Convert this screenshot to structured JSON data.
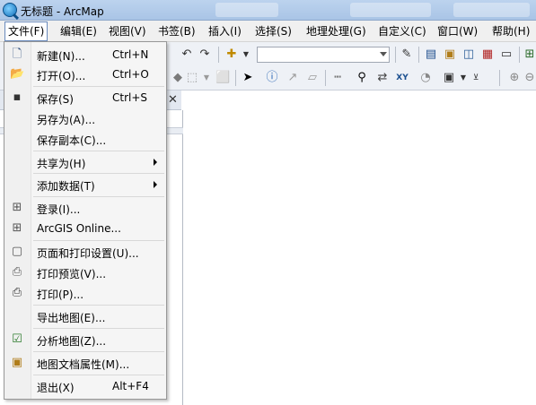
{
  "window": {
    "title": "无标题 - ArcMap"
  },
  "menubar": {
    "items": [
      {
        "label": "文件(F)"
      },
      {
        "label": "编辑(E)"
      },
      {
        "label": "视图(V)"
      },
      {
        "label": "书签(B)"
      },
      {
        "label": "插入(I)"
      },
      {
        "label": "选择(S)"
      },
      {
        "label": "地理处理(G)"
      },
      {
        "label": "自定义(C)"
      },
      {
        "label": "窗口(W)"
      },
      {
        "label": "帮助(H)"
      }
    ],
    "active": "文件(F)"
  },
  "toolbar": {
    "scale_value": "",
    "icons": [
      "new-doc-icon",
      "open-icon",
      "save-icon",
      "print-icon",
      "cut-icon",
      "copy-icon",
      "paste-icon",
      "delete-icon",
      "undo-icon",
      "redo-icon",
      "add-data-icon",
      "scale-dropdown",
      "editor-icon",
      "toc-window-icon",
      "catalog-icon",
      "search-window-icon",
      "arctoolbox-icon",
      "python-icon",
      "model-builder-icon",
      "zoom-in-icon",
      "zoom-out-icon",
      "pan-icon",
      "full-extent-icon",
      "select-elements-icon",
      "identify-icon",
      "html-popup-icon",
      "measure-icon",
      "find-icon",
      "find-route-icon",
      "goto-xy-icon",
      "time-slider-icon",
      "create-viewer-window-icon"
    ]
  },
  "toc": {
    "close_glyph": "✕"
  },
  "file_menu": {
    "items": [
      {
        "label": "新建(N)...",
        "shortcut": "Ctrl+N",
        "icon": "new-doc-icon"
      },
      {
        "label": "打开(O)...",
        "shortcut": "Ctrl+O",
        "icon": "open-folder-icon"
      },
      {
        "label": "保存(S)",
        "shortcut": "Ctrl+S",
        "icon": "save-icon"
      },
      {
        "label": "另存为(A)...",
        "shortcut": "",
        "icon": ""
      },
      {
        "label": "保存副本(C)...",
        "shortcut": "",
        "icon": ""
      },
      {
        "label": "共享为(H)",
        "shortcut": "",
        "icon": "",
        "submenu": true
      },
      {
        "label": "添加数据(T)",
        "shortcut": "",
        "icon": "",
        "submenu": true
      },
      {
        "label": "登录(I)...",
        "shortcut": "",
        "icon": "sign-in-icon"
      },
      {
        "label": "ArcGIS Online...",
        "shortcut": "",
        "icon": "arcgis-online-icon"
      },
      {
        "label": "页面和打印设置(U)...",
        "shortcut": "",
        "icon": "page-setup-icon"
      },
      {
        "label": "打印预览(V)...",
        "shortcut": "",
        "icon": "print-preview-icon"
      },
      {
        "label": "打印(P)...",
        "shortcut": "",
        "icon": "print-icon"
      },
      {
        "label": "导出地图(E)...",
        "shortcut": "",
        "icon": ""
      },
      {
        "label": "分析地图(Z)...",
        "shortcut": "",
        "icon": "analyze-map-icon"
      },
      {
        "label": "地图文档属性(M)...",
        "shortcut": "",
        "icon": "map-document-properties-icon"
      },
      {
        "label": "退出(X)",
        "shortcut": "Alt+F4",
        "icon": ""
      }
    ]
  }
}
